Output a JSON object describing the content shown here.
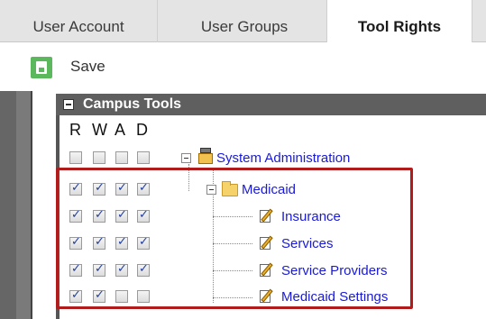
{
  "tabs": [
    {
      "label": "User Account"
    },
    {
      "label": "User Groups"
    },
    {
      "label": "Tool Rights",
      "active": true
    }
  ],
  "toolbar": {
    "save_label": "Save",
    "save_icon": "save-icon"
  },
  "tree": {
    "root_label": "Campus Tools",
    "columns": [
      "R",
      "W",
      "A",
      "D"
    ],
    "items": [
      {
        "label": "System Administration",
        "icon": "admin-tools-icon",
        "rights": [
          false,
          false,
          false,
          false
        ]
      },
      {
        "label": "Medicaid",
        "icon": "folder-icon",
        "rights": [
          true,
          true,
          true,
          true
        ]
      },
      {
        "label": "Insurance",
        "icon": "tool-icon",
        "rights": [
          true,
          true,
          true,
          true
        ]
      },
      {
        "label": "Services",
        "icon": "tool-icon",
        "rights": [
          true,
          true,
          true,
          true
        ]
      },
      {
        "label": "Service Providers",
        "icon": "tool-icon",
        "rights": [
          true,
          true,
          true,
          true
        ]
      },
      {
        "label": "Medicaid Settings",
        "icon": "tool-icon",
        "rights": [
          true,
          true,
          false,
          false
        ]
      }
    ]
  },
  "colors": {
    "highlight": "#b01c1c",
    "header_bg": "#5f5f5f",
    "link": "#1a1ad6",
    "save_green": "#5cb85c"
  }
}
